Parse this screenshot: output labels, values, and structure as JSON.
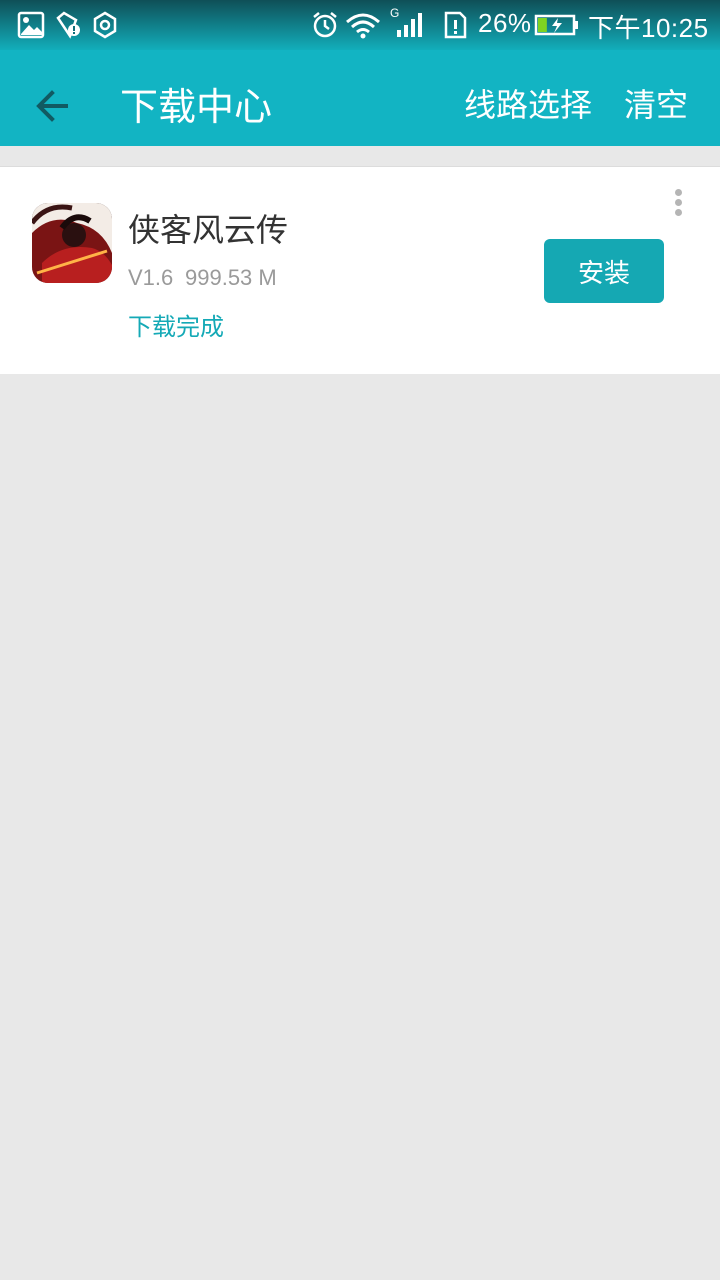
{
  "status_bar": {
    "icons_left": [
      "image-icon",
      "shield-badge-icon",
      "gear-hexagon-icon"
    ],
    "icons_right": [
      "alarm-icon",
      "wifi-icon",
      "signal-icon",
      "sim-alert-icon",
      "battery-charging-icon"
    ],
    "network_label": "G",
    "battery_percent": "26%",
    "battery_level": 0.26,
    "time": "下午10:25"
  },
  "app_bar": {
    "title": "下载中心",
    "back_icon": "arrow-left-icon",
    "actions": {
      "route_select": "线路选择",
      "clear": "清空"
    }
  },
  "downloads": [
    {
      "name": "侠客风云传",
      "version": "V1.6",
      "size": "999.53 M",
      "status": "下载完成",
      "button_label": "安装",
      "icon": "game-icon"
    }
  ],
  "colors": {
    "primary": "#12b4c3",
    "button": "#15a8b3",
    "status_text": "#14a9b6",
    "background": "#e8e8e8"
  }
}
